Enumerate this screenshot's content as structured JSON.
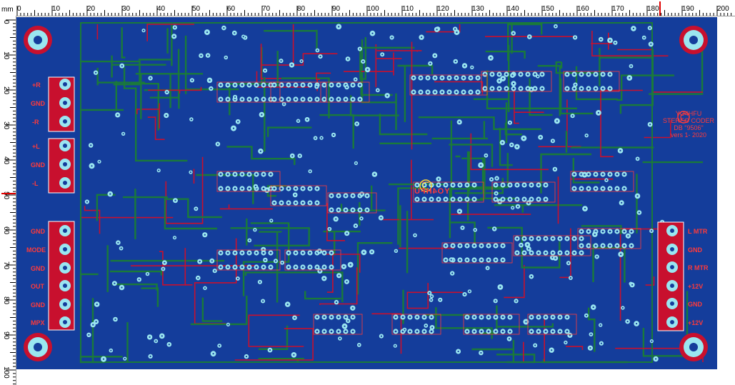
{
  "ruler": {
    "unit": "mm",
    "top_ticks": [
      "0",
      "10",
      "20",
      "30",
      "40",
      "50",
      "60",
      "70",
      "80",
      "90",
      "100",
      "110",
      "120",
      "130",
      "140",
      "150",
      "160",
      "170",
      "180",
      "190",
      "200"
    ],
    "left_ticks": [
      "0",
      "10",
      "20",
      "30",
      "40",
      "50",
      "60",
      "70",
      "80",
      "90",
      "100"
    ]
  },
  "board": {
    "left_connector_a": [
      "+R",
      "GND",
      "-R"
    ],
    "left_connector_b": [
      "+L",
      "GND",
      "-L"
    ],
    "left_connector_c": [
      "GND",
      "MODE",
      "GND",
      "OUT",
      "GND",
      "MPX"
    ],
    "right_connector": [
      "L MTR",
      "GND",
      "R MTR",
      "+12V",
      "GND",
      "+12V"
    ],
    "coder_info": [
      "YO4HFU",
      "STEREO CODER",
      "DB \"9506\"",
      "vers 1- 2020"
    ],
    "center_mark": "YO4HFU"
  },
  "colors": {
    "board_fill": "#143d9b",
    "bottom_trace": "#1a7a3a",
    "top_trace": "#c8102e",
    "pad": "#9ae6f0",
    "silkscreen": "#ff3a3a",
    "cursor": "#e00000"
  },
  "icons": [
    "mounting-hole-icon",
    "terminal-block-icon",
    "logo-icon"
  ]
}
